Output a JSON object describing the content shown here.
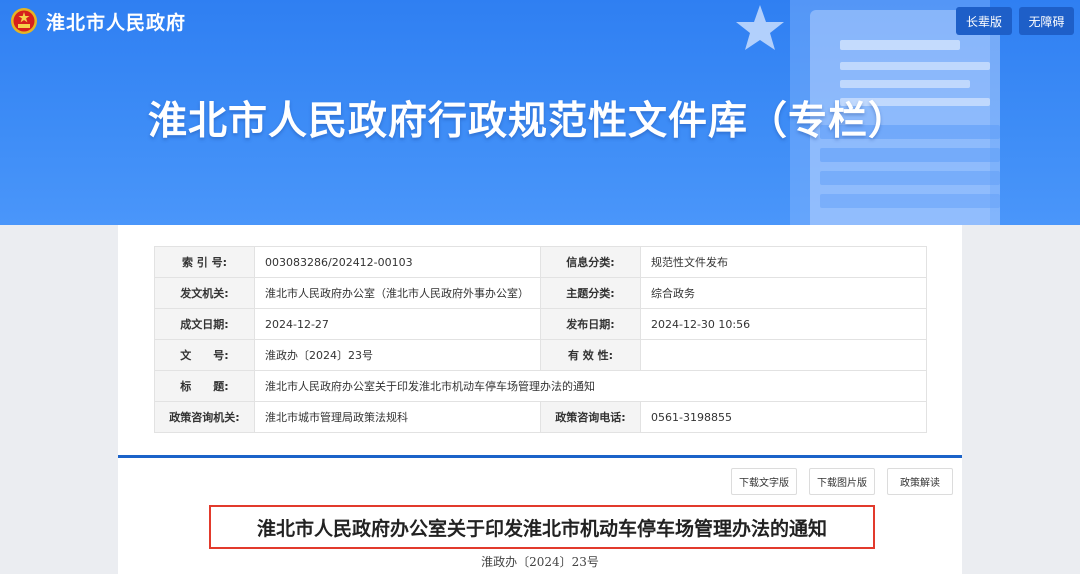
{
  "header": {
    "site_name": "淮北市人民政府",
    "banner_title": "淮北市人民政府行政规范性文件库（专栏）",
    "buttons": {
      "elder": "长辈版",
      "accessible": "无障碍"
    },
    "colors": {
      "banner": "#3d8cf6",
      "button": "#1e5fc8"
    }
  },
  "meta": {
    "rows": [
      {
        "l1": "索 引 号:",
        "v1": "003083286/202412-00103",
        "l2": "信息分类:",
        "v2": "规范性文件发布"
      },
      {
        "l1": "发文机关:",
        "v1": "淮北市人民政府办公室（淮北市人民政府外事办公室）",
        "l2": "主题分类:",
        "v2": "综合政务"
      },
      {
        "l1": "成文日期:",
        "v1": "2024-12-27",
        "l2": "发布日期:",
        "v2": "2024-12-30 10:56"
      },
      {
        "l1": "文　　号:",
        "v1": "淮政办〔2024〕23号",
        "l2": "有 效 性:",
        "v2": ""
      },
      {
        "l1": "标　　题:",
        "v1": "淮北市人民政府办公室关于印发淮北市机动车停车场管理办法的通知"
      },
      {
        "l1": "政策咨询机关:",
        "v1": "淮北市城市管理局政策法规科",
        "l2": "政策咨询电话:",
        "v2": "0561-3198855"
      }
    ]
  },
  "actions": {
    "download_text": "下载文字版",
    "download_image": "下载图片版",
    "interpretation": "政策解读"
  },
  "document": {
    "title": "淮北市人民政府办公室关于印发淮北市机动车停车场管理办法的通知",
    "number": "淮政办〔2024〕23号",
    "highlight_color": "#e23a2c"
  }
}
